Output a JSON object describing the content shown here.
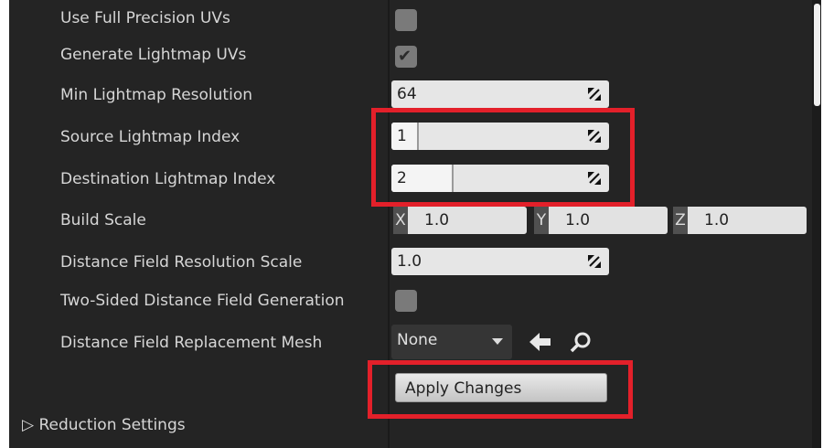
{
  "properties": {
    "use_full_precision_uvs": {
      "label": "Use Full Precision UVs",
      "checked": false
    },
    "generate_lightmap_uvs": {
      "label": "Generate Lightmap UVs",
      "checked": true
    },
    "min_lightmap_resolution": {
      "label": "Min Lightmap Resolution",
      "value": "64"
    },
    "source_lightmap_index": {
      "label": "Source Lightmap Index",
      "value": "1"
    },
    "destination_lightmap_index": {
      "label": "Destination Lightmap Index",
      "value": "2"
    },
    "build_scale": {
      "label": "Build Scale",
      "x_label": "X",
      "x": "1.0",
      "y_label": "Y",
      "y": "1.0",
      "z_label": "Z",
      "z": "1.0"
    },
    "distance_field_resolution_scale": {
      "label": "Distance Field Resolution Scale",
      "value": "1.0"
    },
    "two_sided_distance_field_generation": {
      "label": "Two-Sided Distance Field Generation",
      "checked": false
    },
    "distance_field_replacement_mesh": {
      "label": "Distance Field Replacement Mesh",
      "value": "None"
    }
  },
  "apply_button": {
    "label": "Apply Changes"
  },
  "section": {
    "label": "Reduction Settings",
    "expander": "▷"
  },
  "icons": {
    "checkmark": "✔",
    "use_selected": "arrow-left-icon",
    "browse": "search-icon"
  },
  "colors": {
    "panel_bg": "#242424",
    "label_text": "#d6d6d6",
    "field_bg": "#e6e6e6",
    "highlight": "#e3202a"
  }
}
